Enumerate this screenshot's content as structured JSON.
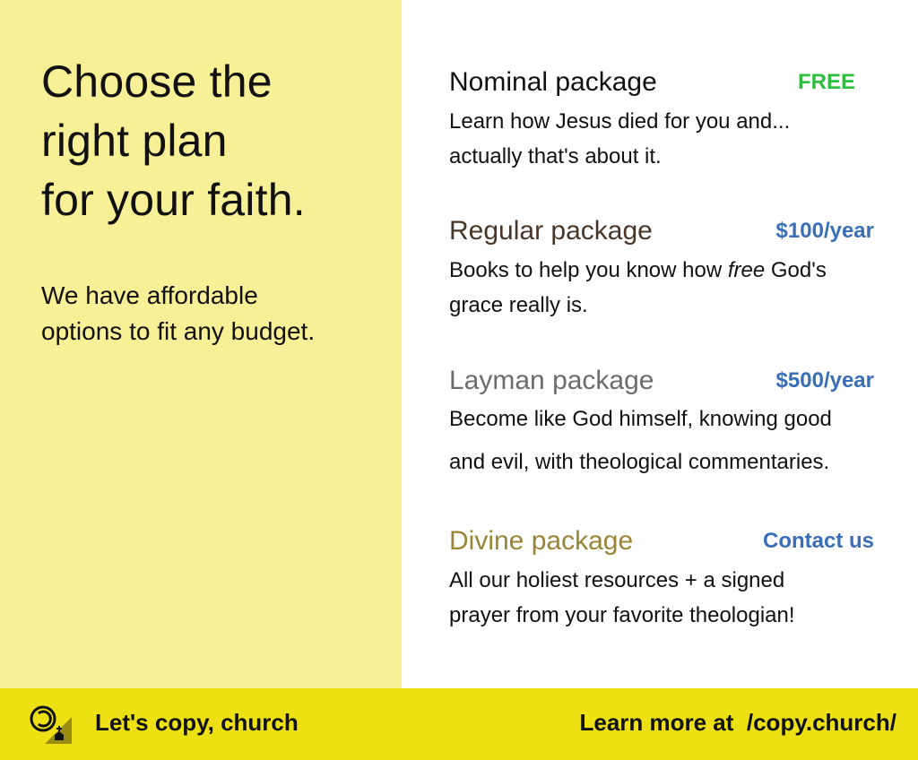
{
  "headline": {
    "lines": [
      "Choose the",
      "right plan",
      "for your faith."
    ]
  },
  "subhead": {
    "lines": [
      "We have affordable",
      "options to fit any budget."
    ]
  },
  "plans": [
    {
      "title": "Nominal package",
      "price": "FREE",
      "description_lines": [
        "Learn how Jesus died for you and...",
        "actually that's about it."
      ]
    },
    {
      "title": "Regular package",
      "price": "$100/year",
      "description_line1_before": "Books to help you know how ",
      "description_line1_emphasis": "free",
      "description_line1_after": " God's",
      "description_line2": "grace really is."
    },
    {
      "title": "Layman package",
      "price": "$500/year",
      "description_lines": [
        "Become like God himself, knowing good",
        "and evil, with theological commentaries."
      ]
    },
    {
      "title": "Divine package",
      "price": "Contact us",
      "description_lines": [
        "All our holiest resources + a signed",
        "prayer from your favorite theologian!"
      ]
    }
  ],
  "footer": {
    "logo_icon": "copyleft-church-logo-icon",
    "left_text": "Let's copy, church",
    "right_text": "Learn more at  /copy.church/"
  },
  "colors": {
    "left_panel_bg": "#f7f097",
    "footer_bg": "#ede013",
    "free_price": "#2fbd3f",
    "paid_price": "#3a6fb8",
    "regular_title": "#4a3628",
    "layman_title": "#6c6c6c",
    "divine_title": "#9a8436"
  }
}
